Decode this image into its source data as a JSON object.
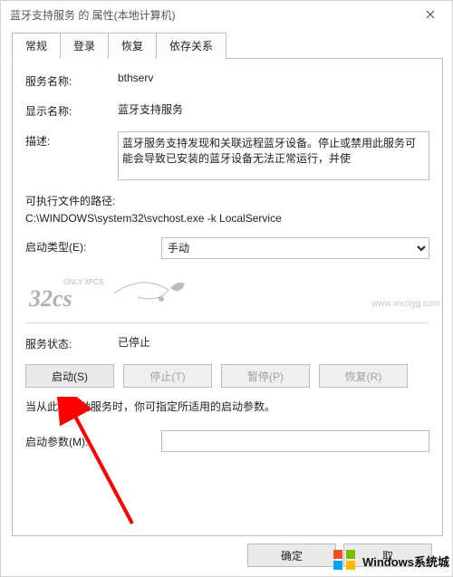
{
  "window": {
    "title": "蓝牙支持服务 的 属性(本地计算机)"
  },
  "tabs": [
    {
      "label": "常规",
      "active": true
    },
    {
      "label": "登录",
      "active": false
    },
    {
      "label": "恢复",
      "active": false
    },
    {
      "label": "依存关系",
      "active": false
    }
  ],
  "fields": {
    "service_name_label": "服务名称:",
    "service_name_value": "bthserv",
    "display_name_label": "显示名称:",
    "display_name_value": "蓝牙支持服务",
    "description_label": "描述:",
    "description_value": "蓝牙服务支持发现和关联远程蓝牙设备。停止或禁用此服务可能会导致已安装的蓝牙设备无法正常运行，并使",
    "exe_path_label": "可执行文件的路径:",
    "exe_path_value": "C:\\WINDOWS\\system32\\svchost.exe -k LocalService",
    "startup_type_label": "启动类型(E):",
    "startup_type_value": "手动",
    "status_label": "服务状态:",
    "status_value": "已停止",
    "note_text": "当从此处启动服务时，你可指定所适用的启动参数。",
    "start_param_label": "启动参数(M):",
    "start_param_value": ""
  },
  "buttons": {
    "start": "启动(S)",
    "stop": "停止(T)",
    "pause": "暂停(P)",
    "resume": "恢复(R)",
    "ok": "确定",
    "cancel": "取"
  },
  "watermark": {
    "url": "www.wxclgg.com",
    "brand": "Windows系统城"
  }
}
